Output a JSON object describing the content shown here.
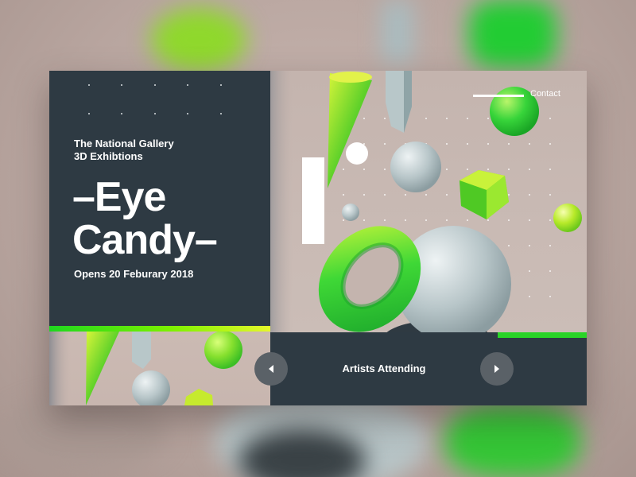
{
  "exhibition": {
    "subtitle_line1": "The National Gallery",
    "subtitle_line2": "3D Exhibtions",
    "headline_line1": "–Eye",
    "headline_line2": "Candy–",
    "opens": "Opens 20 Feburary 2018"
  },
  "nav": {
    "contact": "Contact",
    "carousel_title": "Artists Attending",
    "prev_icon": "chevron-left-icon",
    "next_icon": "chevron-right-icon"
  },
  "colors": {
    "panel": "#2e3a43",
    "accent_green": "#29d427",
    "accent_yellow": "#e7f72b",
    "scene_bg": "#c8b8b2"
  }
}
